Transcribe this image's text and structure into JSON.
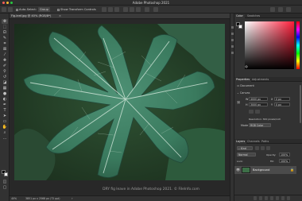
{
  "window": {
    "title": "Adobe Photoshop 2021"
  },
  "options_bar": {
    "auto_select_label": "Auto-Select:",
    "auto_select_value": "Group",
    "show_transform_label": "Show Transform Controls"
  },
  "document": {
    "tab_label": "Fig-leaf.jpg @ 40% (RGB/8*)",
    "zoom": "40%",
    "dimensions": "3851 px x 2568 px (72 ppi)",
    "watermark": "DRY fig leave in Adobe Photoshop 2021. © FileInfo.com"
  },
  "color_panel": {
    "tabs": [
      "Color",
      "Swatches"
    ],
    "hue_colors": [
      "#ff0000",
      "#ffff00",
      "#00ff00",
      "#00ffff",
      "#0000ff",
      "#ff00ff",
      "#ff0000"
    ],
    "base_color": "#ff1e3a"
  },
  "properties_panel": {
    "tabs": [
      "Properties",
      "Adjustments"
    ],
    "doc_label": "Document",
    "canvas_label": "Canvas",
    "width_label": "W",
    "width_value": "4000 px",
    "height_label": "H",
    "height_value": "3000 px",
    "x_value": "0 px",
    "y_value": "0 px",
    "resolution": "Resolution: 300 pixels/inch",
    "mode_label": "Mode",
    "mode_value": "RGB Color"
  },
  "layers_panel": {
    "tabs": [
      "Layers",
      "Channels",
      "Paths"
    ],
    "kind_label": "Kind",
    "blend_mode": "Normal",
    "opacity_label": "Opacity:",
    "opacity_value": "100%",
    "lock_label": "Lock:",
    "fill_label": "Fill:",
    "fill_value": "100%",
    "layer_name": "Background"
  },
  "colors": {
    "foreground": "#000000",
    "background": "#ffffff",
    "ui_dark": "#323232"
  }
}
